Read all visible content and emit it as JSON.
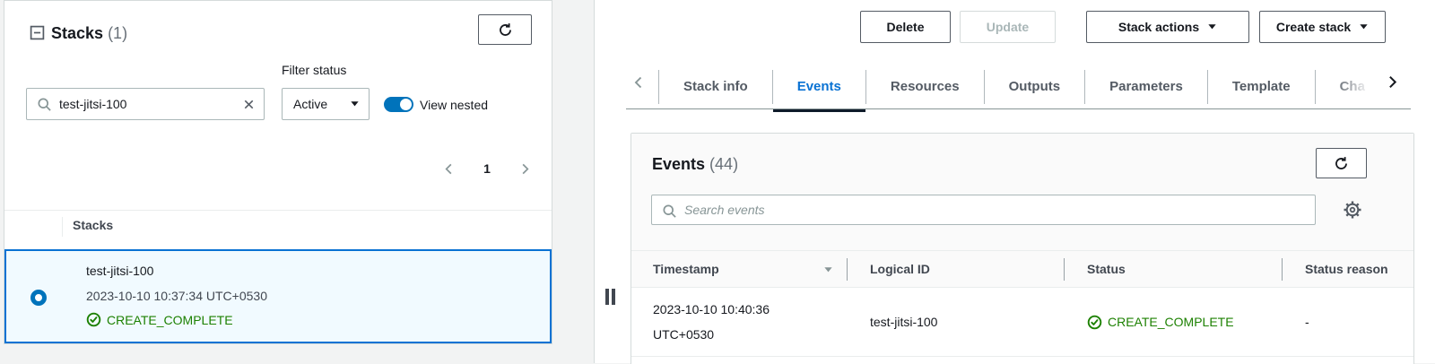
{
  "colors": {
    "accent_blue": "#0972d3",
    "control_blue": "#0073bb",
    "status_green": "#1d8102",
    "selected_row_bg": "#f1faff",
    "page_bg": "#f2f3f3"
  },
  "icons": {
    "collapse": "minus-square",
    "refresh": "circular-arrow",
    "search": "magnifier",
    "clear": "x-cross",
    "dropdown": "caret-down",
    "settings": "gear",
    "status_ok": "check-circle",
    "split_handle": "double-bar"
  },
  "stacks_panel": {
    "title": "Stacks",
    "count": "(1)",
    "filter_status_label": "Filter status",
    "search_value": "test-jitsi-100",
    "status_filter": "Active",
    "view_nested_label": "View nested",
    "page_number": "1",
    "list_header": "Stacks",
    "selected_stack": {
      "name": "test-jitsi-100",
      "created": "2023-10-10 10:37:34 UTC+0530",
      "status": "CREATE_COMPLETE"
    }
  },
  "toolbar": {
    "delete": "Delete",
    "update": "Update",
    "stack_actions": "Stack actions",
    "create_stack": "Create stack"
  },
  "tabs": {
    "active": "Events",
    "items": [
      {
        "label": "Stack info"
      },
      {
        "label": "Events"
      },
      {
        "label": "Resources"
      },
      {
        "label": "Outputs"
      },
      {
        "label": "Parameters"
      },
      {
        "label": "Template"
      },
      {
        "label": "Cha"
      }
    ]
  },
  "events_panel": {
    "title": "Events",
    "count": "(44)",
    "search_placeholder": "Search events",
    "columns": {
      "timestamp": "Timestamp",
      "logical_id": "Logical ID",
      "status": "Status",
      "status_reason": "Status reason"
    },
    "rows": [
      {
        "timestamp": "2023-10-10 10:40:36 UTC+0530",
        "logical_id": "test-jitsi-100",
        "status": "CREATE_COMPLETE",
        "status_reason": "-"
      }
    ]
  }
}
